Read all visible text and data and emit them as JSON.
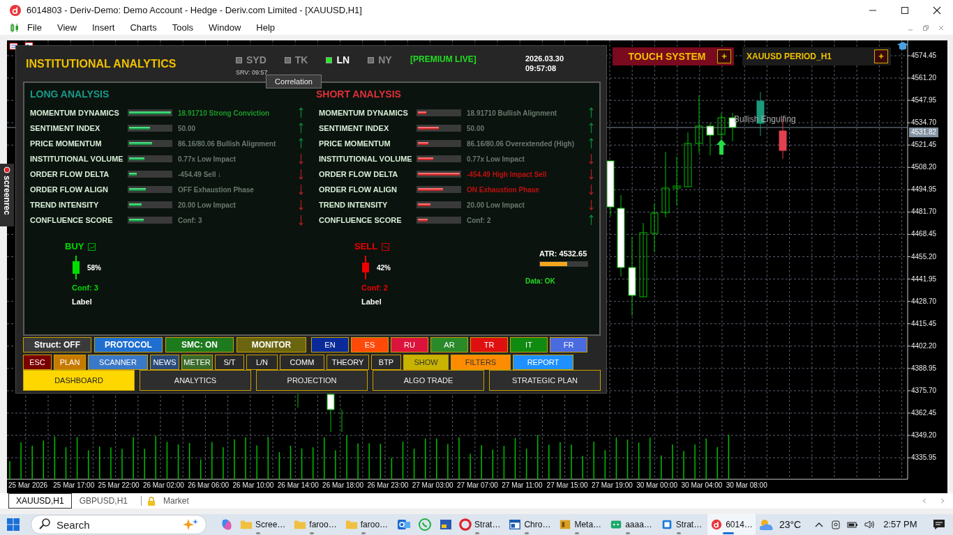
{
  "window": {
    "title": "6014803 - Deriv-Demo: Demo Account - Hedge - Deriv.com Limited - [XAUUSD,H1]"
  },
  "menu": [
    "File",
    "View",
    "Insert",
    "Charts",
    "Tools",
    "Window",
    "Help"
  ],
  "side_tab": {
    "label": "screenrec"
  },
  "chart": {
    "price_axis": [
      "4574.45",
      "4561.20",
      "4547.95",
      "4534.70",
      "4521.45",
      "4508.20",
      "4494.95",
      "4481.70",
      "4468.45",
      "4455.20",
      "4441.95",
      "4428.70",
      "4415.45",
      "4402.20",
      "4388.95",
      "4375.70",
      "4362.45",
      "4349.20",
      "4335.95"
    ],
    "current_price": "4531.82",
    "time_axis": [
      "25 Mar 2026",
      "25 Mar 17:00",
      "25 Mar 22:00",
      "26 Mar 02:00",
      "26 Mar 06:00",
      "26 Mar 10:00",
      "26 Mar 14:00",
      "26 Mar 18:00",
      "26 Mar 23:00",
      "27 Mar 03:00",
      "27 Mar 07:00",
      "27 Mar 11:00",
      "27 Mar 15:00",
      "27 Mar 19:00",
      "30 Mar 00:00",
      "30 Mar 04:00",
      "30 Mar 08:00"
    ],
    "pattern_label": "Bullish Engulfing"
  },
  "touch_panel": {
    "title": "TOUCH SYSTEM",
    "button": "+"
  },
  "symbol_panel": {
    "title": "XAUUSD PERIOD_H1",
    "button": "+"
  },
  "dashboard": {
    "title": "INSTITUTIONAL ANALYTICS",
    "sessions": [
      {
        "label": "SYD",
        "active": false
      },
      {
        "label": "TK",
        "active": false
      },
      {
        "label": "LN",
        "active": true
      },
      {
        "label": "NY",
        "active": false
      }
    ],
    "server_time": "SRV: 09:57",
    "status": "[PREMIUM LIVE]",
    "date": "2026.03.30",
    "time": "09:57:08",
    "tooltip": "Correlation",
    "long": {
      "title": "LONG ANALYSIS",
      "rows": [
        {
          "label": "MOMENTUM DYNAMICS",
          "level": 1,
          "value": "18.91710 Strong Conviction",
          "highlight": true,
          "trend_up": true
        },
        {
          "label": "SENTIMENT INDEX",
          "level": 0.5,
          "value": "50.00",
          "highlight": false,
          "trend_up": true
        },
        {
          "label": "PRICE MOMENTUM",
          "level": 0.55,
          "value": "86.16/80.06 Bullish Alignment",
          "highlight": false,
          "trend_up": true
        },
        {
          "label": "INSTITUTIONAL VOLUME",
          "level": 0.36,
          "value": "0.77x Low Impact",
          "highlight": false,
          "trend_up": false
        },
        {
          "label": "ORDER FLOW DELTA",
          "level": 0.19,
          "value": "-454.49 Sell ↓",
          "highlight": false,
          "trend_up": false
        },
        {
          "label": "ORDER FLOW ALIGN",
          "level": 0.4,
          "value": "OFF Exhaustion Phase",
          "highlight": false,
          "trend_up": false
        },
        {
          "label": "TREND INTENSITY",
          "level": 0.3,
          "value": "20.00 Low Impact",
          "highlight": false,
          "trend_up": false
        },
        {
          "label": "CONFLUENCE SCORE",
          "level": 0.35,
          "value": "Conf: 3",
          "highlight": false,
          "trend_up": false
        }
      ],
      "signal": {
        "label": "BUY",
        "percent": "58%",
        "confidence": "Conf: 3",
        "caption": "Label"
      }
    },
    "short": {
      "title": "SHORT ANALYSIS",
      "rows": [
        {
          "label": "MOMENTUM DYNAMICS",
          "level": 0.2,
          "value": "18.91710 Bullish Alignment",
          "highlight": false,
          "trend_up": true
        },
        {
          "label": "SENTIMENT INDEX",
          "level": 0.5,
          "value": "50.00",
          "highlight": false,
          "trend_up": true
        },
        {
          "label": "PRICE MOMENTUM",
          "level": 0.25,
          "value": "86.16/80.06 Overextended (High)",
          "highlight": false,
          "trend_up": true
        },
        {
          "label": "INSTITUTIONAL VOLUME",
          "level": 0.37,
          "value": "0.77x Low Impact",
          "highlight": false,
          "trend_up": false
        },
        {
          "label": "ORDER FLOW DELTA",
          "level": 1,
          "value": "-454.49 High Impact Sell",
          "highlight": true,
          "trend_up": false
        },
        {
          "label": "ORDER FLOW ALIGN",
          "level": 0.6,
          "value": "ON Exhaustion Phase",
          "highlight": true,
          "trend_up": false
        },
        {
          "label": "TREND INTENSITY",
          "level": 0.3,
          "value": "20.00 Low Impact",
          "highlight": false,
          "trend_up": false
        },
        {
          "label": "CONFLUENCE SCORE",
          "level": 0.24,
          "value": "Conf: 2",
          "highlight": false,
          "trend_up": true
        }
      ],
      "signal": {
        "label": "SELL",
        "percent": "42%",
        "confidence": "Conf: 2",
        "caption": "Label"
      }
    },
    "atr": {
      "label": "ATR: 4532.65",
      "level": 0.57
    },
    "data_status": "Data: OK",
    "toggle_buttons": [
      {
        "label": "Struct: OFF",
        "color": "#3a3a3a"
      },
      {
        "label": "PROTOCOL",
        "color": "#1e6fd0"
      },
      {
        "label": "SMC: ON",
        "color": "#1d7a1d"
      },
      {
        "label": "MONITOR",
        "color": "#6b6510"
      }
    ],
    "language_buttons": [
      {
        "label": "EN",
        "color": "#0a2a9a"
      },
      {
        "label": "ES",
        "color": "#ff4a0a"
      },
      {
        "label": "RU",
        "color": "#dc143c"
      },
      {
        "label": "AR",
        "color": "#2a8a2a"
      },
      {
        "label": "TR",
        "color": "#e01010"
      },
      {
        "label": "IT",
        "color": "#108a10"
      },
      {
        "label": "FR",
        "color": "#4a6ae0"
      }
    ],
    "tool_buttons": [
      {
        "label": "ESC",
        "color": "#7a0000"
      },
      {
        "label": "PLAN",
        "color": "#c87a00"
      },
      {
        "label": "SCANNER",
        "color": "#3a78c8"
      },
      {
        "label": "NEWS",
        "color": "#2a4a7a"
      },
      {
        "label": "METER",
        "color": "#3a6a2a"
      },
      {
        "label": "S/T",
        "color": "#2a2a2a"
      },
      {
        "label": "L/N",
        "color": "#2a2a2a"
      },
      {
        "label": "COMM",
        "color": "#2a2a2a"
      },
      {
        "label": "THEORY",
        "color": "#2a2a2a"
      },
      {
        "label": "BTP",
        "color": "#2a2a2a"
      },
      {
        "label": "SHOW",
        "color": "#c8b400"
      },
      {
        "label": "FILTERS",
        "color": "#ff8c00"
      },
      {
        "label": "REPORT",
        "color": "#1e90ff"
      }
    ],
    "tabs": [
      {
        "label": "DASHBOARD",
        "selected": true
      },
      {
        "label": "ANALYTICS",
        "selected": false
      },
      {
        "label": "PROJECTION",
        "selected": false
      },
      {
        "label": "ALGO TRADE",
        "selected": false
      },
      {
        "label": "STRATEGIC PLAN",
        "selected": false
      }
    ]
  },
  "chart_tabs": [
    {
      "label": "XAUUSD,H1",
      "selected": true
    },
    {
      "label": "GBPUSD,H1",
      "selected": false
    }
  ],
  "market_button": "Market",
  "taskbar": {
    "search": {
      "placeholder": "Search"
    },
    "apps": [
      {
        "label": "Scree…",
        "selected": false
      },
      {
        "label": "faroo…",
        "selected": false
      },
      {
        "label": "faroo…",
        "selected": false
      },
      {
        "label": "Strat…",
        "selected": false
      },
      {
        "label": "Chro…",
        "selected": false
      },
      {
        "label": "Meta…",
        "selected": false
      },
      {
        "label": "aaaa…",
        "selected": false
      },
      {
        "label": "Strat…",
        "selected": false
      },
      {
        "label": "6014…",
        "selected": true
      }
    ],
    "weather": "23°C",
    "clock": "2:57 PM"
  }
}
